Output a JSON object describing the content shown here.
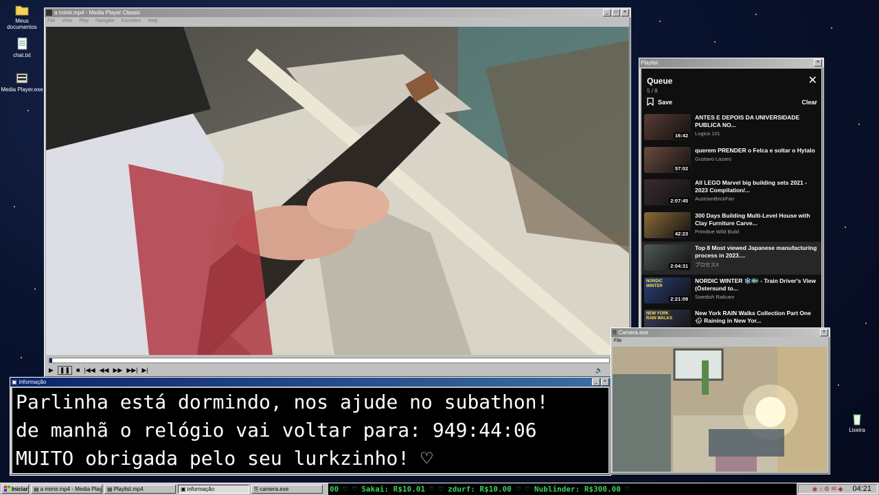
{
  "desktop": {
    "icons": [
      {
        "label": "Meus documentos",
        "icon": "folder-icon"
      },
      {
        "label": "chat.txt",
        "icon": "text-file-icon"
      },
      {
        "label": "Media Player.exe",
        "icon": "media-player-icon"
      },
      {
        "label": "Lixeira",
        "icon": "recycle-bin-icon"
      }
    ]
  },
  "player": {
    "title": "a mimir.mp4 - Media Player Classic",
    "menu": [
      "File",
      "View",
      "Play",
      "Navigate",
      "Favorites",
      "Help"
    ],
    "controls": [
      "play",
      "pause",
      "stop",
      "prev",
      "rewind",
      "forward",
      "next",
      "frame-step"
    ],
    "progress": 0.005
  },
  "playlist_window": {
    "title": "Playlist",
    "header": "Queue",
    "position": "5 / 8",
    "save_label": "Save",
    "clear_label": "Clear",
    "items": [
      {
        "title": "ANTES E DEPOIS DA UNIVERSIDADE PUBLICA NO...",
        "channel": "Logica 101",
        "duration": "16:42",
        "color": "#5a3b34"
      },
      {
        "title": "querem PRENDER o Felca e soltar o Hytalo",
        "channel": "Gustavo Lazaro",
        "duration": "57:02",
        "color": "#6c4b3d"
      },
      {
        "title": "All LEGO Marvel big building sets 2021 - 2023 Compilation/...",
        "channel": "AustrianBrickFan",
        "duration": "2:07:45",
        "color": "#3a2a33"
      },
      {
        "title": "300 Days Building Multi-Level House with Clay Furniture Carve...",
        "channel": "Primitive Wild Build",
        "duration": "42:23",
        "color": "#8a6a3a"
      },
      {
        "title": "Top 8 Most viewed Japanese manufacturing process in 2023....",
        "channel": "プロセスX",
        "duration": "2:04:31",
        "color": "#4d5a55",
        "selected": true
      },
      {
        "title": "NORDIC WINTER ❄️🇸🇪 - Train Driver's View (Östersund to...",
        "channel": "Swedish Railcam",
        "duration": "2:21:09",
        "color": "#2a3f7a",
        "thumb_text": "NORDIC WINTER"
      },
      {
        "title": "New York RAIN Walks Collection Part One 🌧 Raining in New Yor...",
        "channel": "",
        "duration": "",
        "color": "#3b3f57",
        "thumb_text": "NEW YORK RAIN WALKS"
      }
    ]
  },
  "info_window": {
    "title": "informação",
    "lines": [
      "Parlinha está dormindo, nos ajude no subathon!",
      "de manhã o relógio vai voltar para:  949:44:06",
      "MUITO obrigada pelo seu lurkzinho! ♡"
    ]
  },
  "camera_window": {
    "title": "Camera.exe",
    "menu": [
      "File"
    ]
  },
  "taskbar": {
    "start_label": "Iniciar",
    "tasks": [
      {
        "label": "a mimir.mp4 - Media Playe...",
        "active": false
      },
      {
        "label": "Playlist.mp4",
        "active": false
      },
      {
        "label": "informação",
        "active": true
      },
      {
        "label": "camera.exe",
        "active": false
      }
    ],
    "ticker": "00 ♡   ♡ Sakai: R$10.01 ♡   ♡ zdurf: R$10.00 ♡   ♡ Nublinder: R$300.00 ♡",
    "clock": "04:21"
  }
}
